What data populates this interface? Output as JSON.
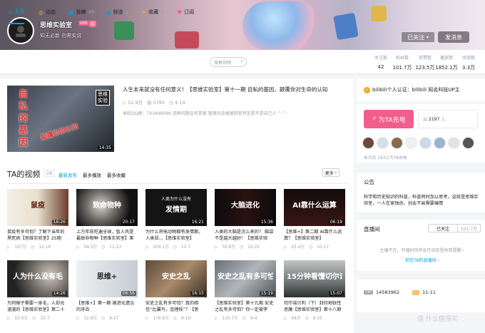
{
  "header": {
    "username": "思维实验室",
    "level_badge": "LV6",
    "vip_badge": "年",
    "signature": "知无必新 勿需实说",
    "followed_label": "已关注",
    "message_label": "发消息"
  },
  "nav": {
    "tabs": [
      {
        "label": "主页",
        "icon": "home-icon",
        "count": ""
      },
      {
        "label": "动态",
        "icon": "dynamic-icon",
        "count": ""
      },
      {
        "label": "投稿",
        "icon": "upload-icon",
        "count": "46"
      },
      {
        "label": "频道",
        "icon": "channel-icon",
        "count": "1"
      },
      {
        "label": "收藏",
        "icon": "star-icon",
        "count": "3"
      },
      {
        "label": "订阅",
        "icon": "heart-icon",
        "count": ""
      }
    ],
    "search_placeholder": "搜索视频"
  },
  "stats": [
    {
      "label": "关注数",
      "value": "42"
    },
    {
      "label": "粉丝数",
      "value": "101.7万"
    },
    {
      "label": "获赞数",
      "value": "123.5万"
    },
    {
      "label": "播放数",
      "value": "1852.1万"
    },
    {
      "label": "阅读数",
      "value": "3.3万"
    }
  ],
  "featured": {
    "title": "人生本来就没有任何意义！【思维实验室】第十一期 自私的基因，颠覆你对生命的认知",
    "plays": "52.9万",
    "danmaku": "5785",
    "date": "4-19",
    "desc": "米哈QQ群：741848096 进群问题没有答案 管理员会根据回答判定是不是自己人 ^-^",
    "duration": "14:35",
    "thumb_text": "自私的基因",
    "thumb_badge": "思维实验",
    "thumb_stamp": "颠覆你的认知"
  },
  "videos_section": {
    "title": "TA的视频",
    "count": "28",
    "sorts": [
      "最新发布",
      "最多播放",
      "最多收藏"
    ],
    "more_label": "更多"
  },
  "videos": [
    {
      "title": "鼠疫有多可怕？了解下当年的黑死病【思维实验室】25期",
      "plays": "167万",
      "date": "12-16",
      "duration": "16:26",
      "thumb_text": "鼠疫",
      "thumb_style": "t1"
    },
    {
      "title": "上万年前吃遍全球，智人凭是最致命物种【思维实验室】第二",
      "plays": "54.5万",
      "date": "11-23",
      "duration": "20:17",
      "thumb_text": "致命物种",
      "thumb_style": "t2"
    },
    {
      "title": "为什么将电动物都有发情期，人类却，，【思维实验室】",
      "plays": "204.1万",
      "date": "11-7",
      "duration": "16:21",
      "thumb_text": "发情期",
      "thumb_sub": "人类为什么没有",
      "thumb_style": "t3"
    },
    {
      "title": "人类的大脑是怎么来的？ 脑袋不是越大越好！【思维实验",
      "plays": "50.8万",
      "date": "10-22",
      "duration": "15:36",
      "thumb_text": "大脑进化",
      "thumb_style": "t4"
    },
    {
      "title": "【思维+】第二期 AI靠什么运算？【思维实验室】",
      "plays": "25.4万",
      "date": "10-17",
      "duration": "06:19",
      "thumb_text": "AI靠什么运算",
      "thumb_style": "t5"
    },
    {
      "title": "为何猴子需要一身毛，人却光溜溜的【思维实验室】第二十",
      "plays": "55.6万",
      "date": "10-7",
      "duration": "14:26",
      "thumb_text": "人为什么没有毛",
      "thumb_style": "t6"
    },
    {
      "title": "【思维+】第一期 被进化遗忘的牙齿",
      "plays": "52.8万",
      "date": "9-27",
      "duration": "06:56",
      "thumb_text": "思维+",
      "thumb_style": "t7"
    },
    {
      "title": "安史之乱有多可怕？真的相信“比翼鸟，连理枝”？【思",
      "plays": "176.9万",
      "date": "9-19",
      "duration": "16:15",
      "thumb_text": "安史之乱",
      "thumb_style": "t8"
    },
    {
      "title": "【思维实验室】第十九期 安史之乱有多可怕？你一定被李",
      "plays": "110.7万",
      "date": "9-4",
      "duration": "15:19",
      "thumb_text": "安史之乱有多可怕",
      "thumb_style": "t9"
    },
    {
      "title": "切尔诺贝利（下）封印地狱性恶魔【思维实验室】第十八期",
      "plays": "64万",
      "date": "8-15",
      "duration": "15:07",
      "thumb_text": "15分钟看懂切尔诺贝利",
      "thumb_style": "t10"
    }
  ],
  "sidebar": {
    "cert_label": "bilibili个人认证：bilibili 知名科技UP主",
    "charge_label": "为TA充电",
    "charge_total_prefix": "共",
    "charge_total": "2197",
    "charge_total_suffix": "人",
    "charge_note": "本月共 193人为TA充电",
    "notice_title": "公告",
    "notice_text": "科学和历史知识的科普，科普同时加以思考，这就是思维实验室，一人在家独创，创业不易需要编情",
    "live_title": "直播间",
    "live_followed": "已关注",
    "live_count": "101.7万",
    "live_empty": "主播不在，开播时你将会在动态里收到提醒~",
    "live_link": "前往TA的直播间",
    "uid_label": "UID",
    "uid": "14583962",
    "birthday": "11-11"
  },
  "watermark": "值 什么值得买",
  "colors": {
    "accent": "#00a1d6",
    "pink": "#f25d8e",
    "gray": "#99a2aa"
  }
}
